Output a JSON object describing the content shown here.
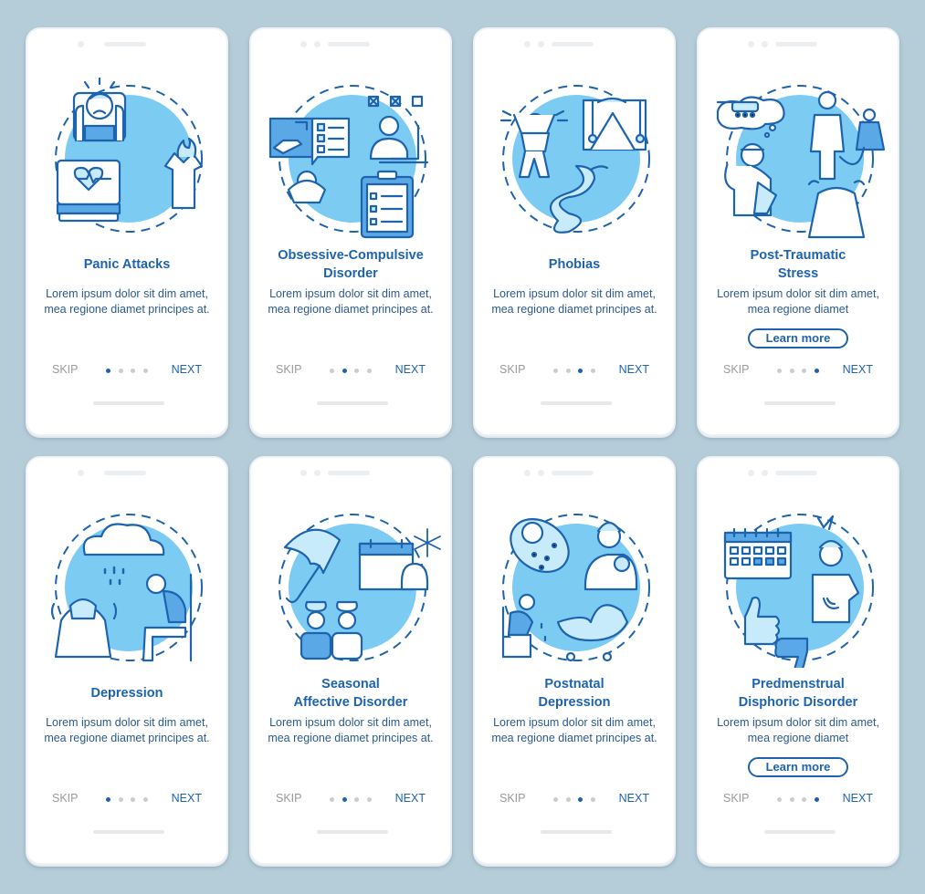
{
  "colors": {
    "background": "#b5cdd9",
    "accent": "#1e63ae",
    "circle_fill": "#7ccbf2",
    "light_fill": "#c7ebfb",
    "muted": "#9a9a9a"
  },
  "screens": [
    {
      "title": "Panic Attacks",
      "body": "Lorem ipsum dolor sit dim amet, mea regione diamet principes at.",
      "skip": "SKIP",
      "next": "NEXT",
      "page_index": 1,
      "page_count": 4,
      "illustration": "panic-attacks-illustration",
      "learn_more": null
    },
    {
      "title": "Obsessive-Compulsive Disorder",
      "body": "Lorem ipsum dolor sit dim amet, mea regione diamet principes at.",
      "skip": "SKIP",
      "next": "NEXT",
      "page_index": 2,
      "page_count": 4,
      "illustration": "ocd-illustration",
      "learn_more": null
    },
    {
      "title": "Phobias",
      "body": "Lorem ipsum dolor sit dim amet, mea regione diamet principes at.",
      "skip": "SKIP",
      "next": "NEXT",
      "page_index": 3,
      "page_count": 4,
      "illustration": "phobias-illustration",
      "learn_more": null
    },
    {
      "title": "Post-Traumatic Stress",
      "body": "Lorem ipsum dolor sit dim amet, mea regione diamet",
      "skip": "SKIP",
      "next": "NEXT",
      "page_index": 4,
      "page_count": 4,
      "illustration": "ptsd-illustration",
      "learn_more": "Learn more"
    },
    {
      "title": "Depression",
      "body": "Lorem ipsum dolor sit dim amet, mea regione diamet principes at.",
      "skip": "SKIP",
      "next": "NEXT",
      "page_index": 1,
      "page_count": 4,
      "illustration": "depression-illustration",
      "learn_more": null
    },
    {
      "title": "Seasonal Affective Disorder",
      "body": "Lorem ipsum dolor sit dim amet, mea regione diamet principes at.",
      "skip": "SKIP",
      "next": "NEXT",
      "page_index": 2,
      "page_count": 4,
      "illustration": "seasonal-affective-illustration",
      "learn_more": null
    },
    {
      "title": "Postnatal Depression",
      "body": "Lorem ipsum dolor sit dim amet, mea regione diamet principes at.",
      "skip": "SKIP",
      "next": "NEXT",
      "page_index": 3,
      "page_count": 4,
      "illustration": "postnatal-depression-illustration",
      "learn_more": null
    },
    {
      "title": "Predmenstrual Disphoric Disorder",
      "body": "Lorem ipsum dolor sit dim amet, mea regione diamet",
      "skip": "SKIP",
      "next": "NEXT",
      "page_index": 4,
      "page_count": 4,
      "illustration": "pmdd-illustration",
      "learn_more": "Learn more"
    }
  ]
}
